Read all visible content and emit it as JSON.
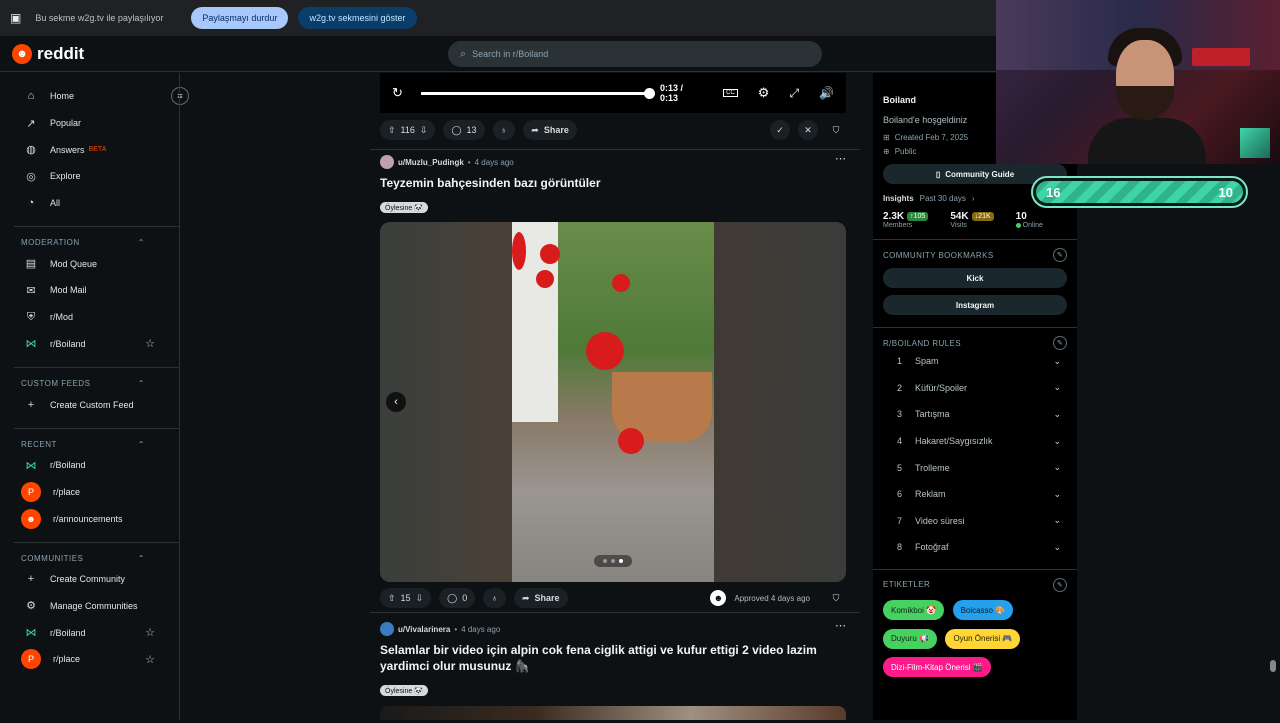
{
  "share_bar": {
    "message": "Bu sekme w2g.tv ile paylaşılıyor",
    "stop_label": "Paylaşmayı durdur",
    "show_label": "w2g.tv sekmesini göster"
  },
  "header": {
    "brand": "reddit",
    "search_placeholder": "Search in r/Boiland"
  },
  "sidebar": {
    "nav": [
      "Home",
      "Popular",
      "Answers",
      "Explore",
      "All"
    ],
    "beta": "BETA",
    "moderation_title": "MODERATION",
    "moderation": [
      "Mod Queue",
      "Mod Mail",
      "r/Mod",
      "r/Boiland"
    ],
    "custom_feeds_title": "CUSTOM FEEDS",
    "create_custom_feed": "Create Custom Feed",
    "recent_title": "RECENT",
    "recent": [
      "r/Boiland",
      "r/place",
      "r/announcements"
    ],
    "communities_title": "COMMUNITIES",
    "create_community": "Create Community",
    "manage_communities": "Manage Communities",
    "communities": [
      "r/Boiland",
      "r/place"
    ]
  },
  "video": {
    "time": "0:13 / 0:13",
    "progress": 1.0
  },
  "post0_actions": {
    "votes": "116",
    "comments": "13",
    "share": "Share"
  },
  "post1": {
    "user": "u/Muzlu_Pudingk",
    "age": "4 days ago",
    "title": "Teyzemin bahçesinden bazı görüntüler",
    "flair": "Öylesine 🐼",
    "votes": "15",
    "comments": "0",
    "share": "Share",
    "approved": "Approved 4 days ago",
    "gallery_index": 3,
    "gallery_count": 3
  },
  "post2": {
    "user": "u/Vivalarinera",
    "age": "4 days ago",
    "title": "Selamlar bir video için alpin cok fena ciglik attigi ve kufur ettigi 2 video lazim yardimci olur musunuz 🦍",
    "flair": "Öylesine 🐼"
  },
  "community": {
    "name": "Boiland",
    "welcome": "Boiland'e hoşgeldiniz",
    "created": "Created Feb 7, 2025",
    "visibility": "Public",
    "guide_label": "Community Guide",
    "insights_label": "Insights",
    "insights_period": "Past 30 days",
    "members": "2.3K",
    "members_delta": "↑105",
    "members_label": "Members",
    "visits": "54K",
    "visits_delta": "↓21K",
    "visits_label": "Visits",
    "online": "10",
    "online_label": "Online",
    "bookmarks_title": "COMMUNITY BOOKMARKS",
    "bookmarks": [
      "Kick",
      "Instagram"
    ],
    "rules_title": "R/BOILAND RULES",
    "rules": [
      "Spam",
      "Küfür/Spoiler",
      "Tartışma",
      "Hakaret/Saygısızlık",
      "Trolleme",
      "Reklam",
      "Video süresi",
      "Fotoğraf"
    ],
    "tags_title": "ETIKETLER",
    "tags": [
      {
        "label": "Komikboi 🤡",
        "color": "#46d160",
        "text": "#0a2a10"
      },
      {
        "label": "Boicasso 🎨",
        "color": "#24a0ed",
        "text": "#0a1a2a"
      },
      {
        "label": "Duyuru 📢",
        "color": "#46d160",
        "text": "#0a2a10"
      },
      {
        "label": "Oyun Önerisi 🎮",
        "color": "#ffd635",
        "text": "#2a2000"
      },
      {
        "label": "Dizi-Film-Kitap Önerisi 🎬",
        "color": "#ff1a8c",
        "text": "#fff"
      }
    ]
  },
  "overlay": {
    "left_value": "16",
    "right_value": "10",
    "fill": 1.0
  },
  "colors": {
    "accent": "#ff4500",
    "bg": "#0e1113"
  }
}
